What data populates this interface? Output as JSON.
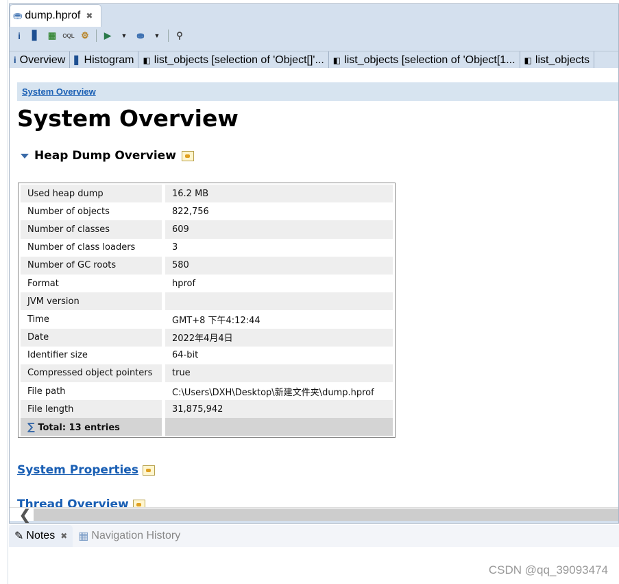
{
  "editor_tab": {
    "label": "dump.hprof",
    "icon": "database-icon"
  },
  "toolbar": {
    "icons": [
      "info-icon",
      "histogram-icon",
      "dominator-tree-icon",
      "oql-icon",
      "thread-gears-icon",
      "run-report-icon",
      "dropdown-icon",
      "query-browser-icon",
      "dropdown-icon",
      "search-icon"
    ]
  },
  "subtabs": [
    {
      "label": "Overview",
      "icon": "info-icon"
    },
    {
      "label": "Histogram",
      "icon": "histogram-icon"
    },
    {
      "label": "list_objects  [selection of 'Object[]'...",
      "icon": "document-icon"
    },
    {
      "label": "list_objects  [selection of 'Object[1...",
      "icon": "document-icon"
    },
    {
      "label": "list_objects",
      "icon": "document-icon"
    }
  ],
  "breadcrumb": "System Overview",
  "page_title": "System Overview",
  "section": {
    "title": "Heap Dump Overview"
  },
  "table": {
    "rows": [
      [
        "Used heap dump",
        "16.2 MB"
      ],
      [
        "Number of objects",
        "822,756"
      ],
      [
        "Number of classes",
        "609"
      ],
      [
        "Number of class loaders",
        "3"
      ],
      [
        "Number of GC roots",
        "580"
      ],
      [
        "Format",
        "hprof"
      ],
      [
        "JVM version",
        ""
      ],
      [
        "Time",
        "GMT+8 下午4:12:44"
      ],
      [
        "Date",
        "2022年4月4日"
      ],
      [
        "Identifier size",
        "64-bit"
      ],
      [
        "Compressed object pointers",
        "true"
      ],
      [
        "File path",
        "C:\\Users\\DXH\\Desktop\\新建文件夹\\dump.hprof"
      ],
      [
        "File length",
        "31,875,942"
      ]
    ],
    "total": "Total: 13 entries"
  },
  "links": {
    "system_properties": "System Properties",
    "thread_overview": "Thread Overview"
  },
  "bottom_tabs": {
    "notes": "Notes",
    "navigation_history": "Navigation History"
  },
  "watermark": "CSDN @qq_39093474"
}
